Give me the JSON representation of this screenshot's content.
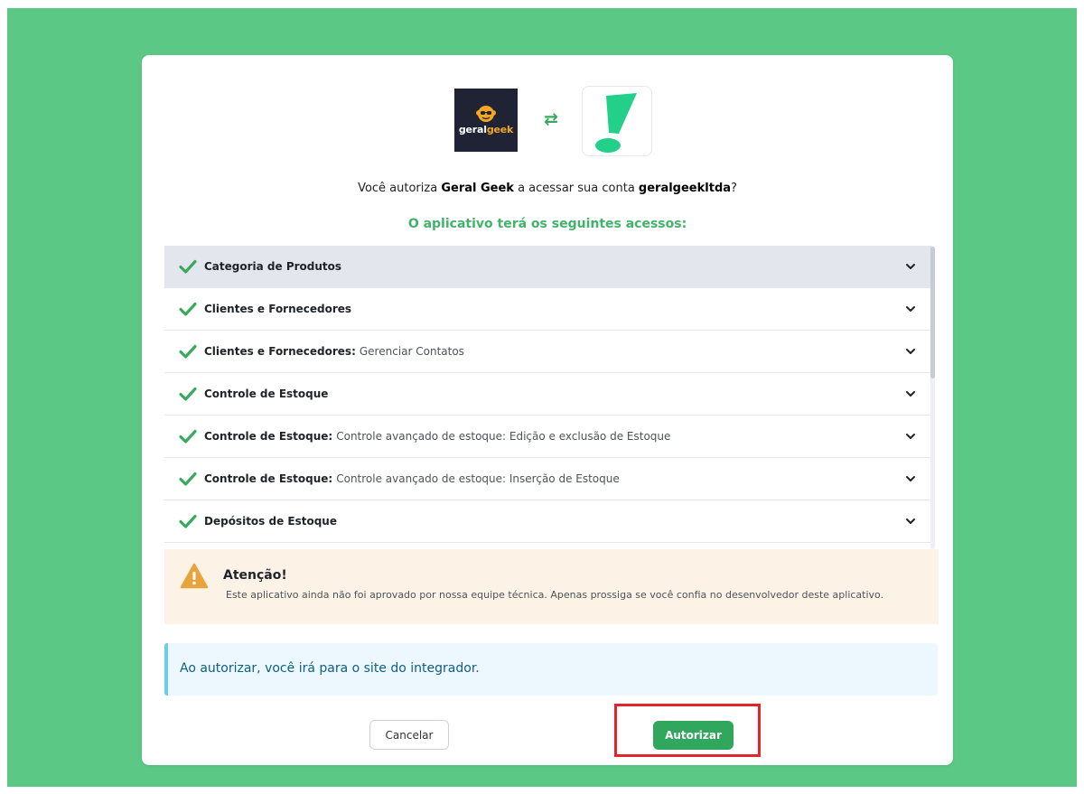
{
  "auth": {
    "app_logo": {
      "icon": "geralgeek-logo",
      "word1": "geral",
      "word2": "geek"
    },
    "swap_icon": "swap-arrows-icon",
    "platform_logo": {
      "icon": "bling-exclamation-logo",
      "color": "#22d08a"
    },
    "question": {
      "prefix": "Você autoriza ",
      "app_name": "Geral Geek",
      "middle": " a acessar sua conta ",
      "account": "geralgeekltda",
      "suffix": "?"
    },
    "subheading": "O aplicativo terá os seguintes acessos:"
  },
  "permissions": [
    {
      "name": "Categoria de Produtos",
      "detail": "",
      "active": true
    },
    {
      "name": "Clientes e Fornecedores",
      "detail": "",
      "active": false
    },
    {
      "name": "Clientes e Fornecedores:",
      "detail": "Gerenciar Contatos",
      "active": false
    },
    {
      "name": "Controle de Estoque",
      "detail": "",
      "active": false
    },
    {
      "name": "Controle de Estoque:",
      "detail": "Controle avançado de estoque: Edição e exclusão de Estoque",
      "active": false
    },
    {
      "name": "Controle de Estoque:",
      "detail": "Controle avançado de estoque: Inserção de Estoque",
      "active": false
    },
    {
      "name": "Depósitos de Estoque",
      "detail": "",
      "active": false
    }
  ],
  "list_scroll_position": 0,
  "warning": {
    "title": "Atenção!",
    "text": "Este aplicativo ainda não foi aprovado por nossa equipe técnica. Apenas prossiga se você confia no desenvolvedor deste aplicativo."
  },
  "info": {
    "text": "Ao autorizar, você irá para o site do integrador."
  },
  "buttons": {
    "cancel": "Cancelar",
    "authorize": "Autorizar"
  },
  "colors": {
    "background": "#5bc885",
    "accent_green": "#31a75d",
    "subheading_green": "#3fb46a",
    "check_green": "#3aa95f",
    "highlight_red": "#e3242b",
    "warning_bg": "#fcf3e6",
    "warning_icon": "#e8a33d",
    "info_bg": "#edf8fe",
    "info_border": "#69cdee"
  }
}
